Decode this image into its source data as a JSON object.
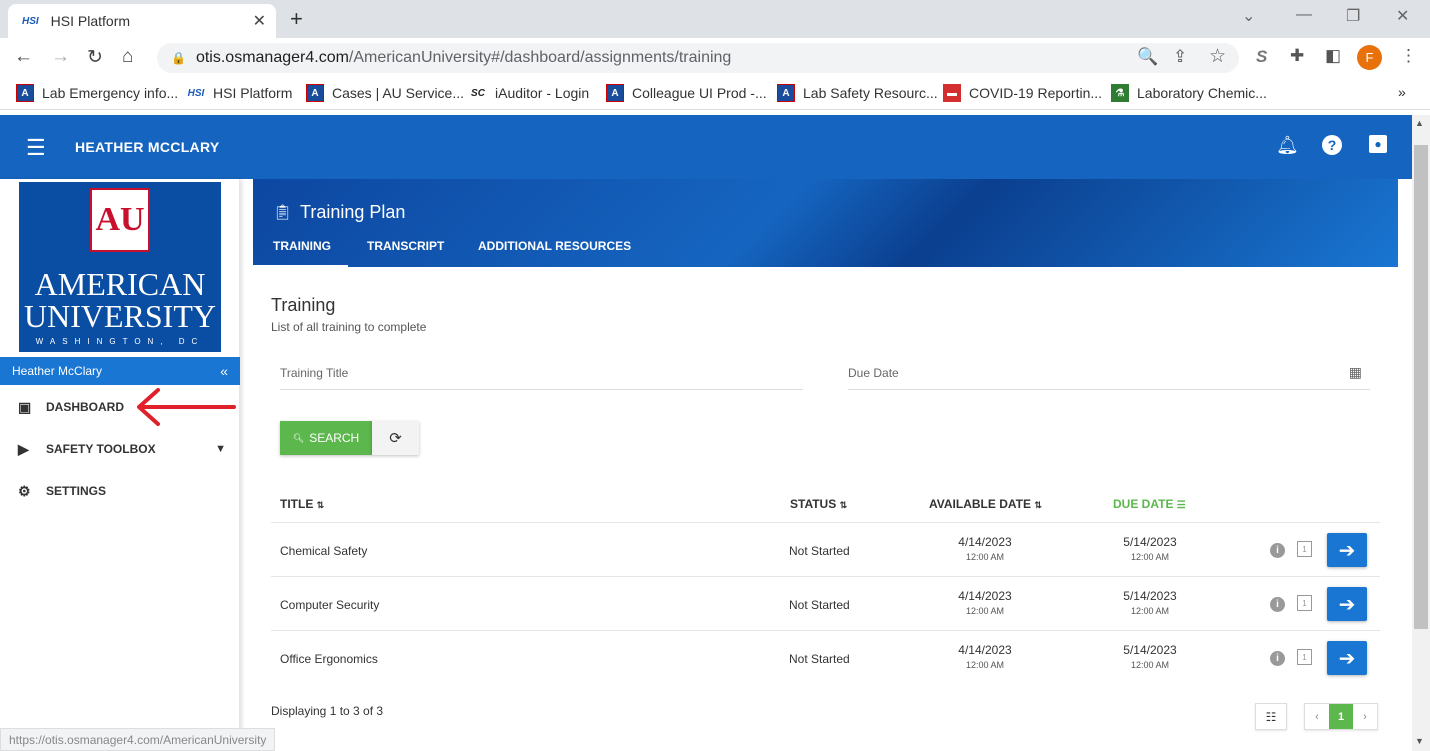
{
  "browser": {
    "tab_title": "HSI Platform",
    "tab_favicon": "HSI",
    "url_host": "otis.osmanager4.com",
    "url_path": "/AmericanUniversity#/dashboard/assignments/training",
    "profile_initial": "F",
    "bookmarks": [
      {
        "label": "Lab Emergency info..."
      },
      {
        "label": "HSI Platform"
      },
      {
        "label": "Cases | AU Service..."
      },
      {
        "label": "iAuditor - Login"
      },
      {
        "label": "Colleague UI Prod -..."
      },
      {
        "label": "Lab Safety Resourc..."
      },
      {
        "label": "COVID-19 Reportin..."
      },
      {
        "label": "Laboratory Chemic..."
      }
    ],
    "bookmarks_overflow": "»",
    "status_url": "https://otis.osmanager4.com/AmericanUniversity"
  },
  "appbar": {
    "user_name": "HEATHER MCCLARY"
  },
  "sidebar": {
    "logo_monogram": "AU",
    "logo_line1": "AMERICAN",
    "logo_line2": "UNIVERSITY",
    "logo_line3": "WASHINGTON, DC",
    "user_label": "Heather McClary",
    "collapse_glyph": "«",
    "items": [
      {
        "label": "DASHBOARD"
      },
      {
        "label": "SAFETY TOOLBOX"
      },
      {
        "label": "SETTINGS"
      }
    ]
  },
  "banner": {
    "title": "Training Plan",
    "tabs": [
      {
        "label": "TRAINING"
      },
      {
        "label": "TRANSCRIPT"
      },
      {
        "label": "ADDITIONAL RESOURCES"
      }
    ]
  },
  "training": {
    "title": "Training",
    "subtitle": "List of all training to complete",
    "title_field_placeholder": "Training Title",
    "due_field_placeholder": "Due Date",
    "search_label": "SEARCH",
    "columns": {
      "title": "TITLE",
      "status": "STATUS",
      "available": "AVAILABLE DATE",
      "due": "DUE DATE"
    },
    "rows": [
      {
        "title": "Chemical Safety",
        "status": "Not Started",
        "available_date": "4/14/2023",
        "available_time": "12:00 AM",
        "due_date": "5/14/2023",
        "due_time": "12:00 AM"
      },
      {
        "title": "Computer Security",
        "status": "Not Started",
        "available_date": "4/14/2023",
        "available_time": "12:00 AM",
        "due_date": "5/14/2023",
        "due_time": "12:00 AM"
      },
      {
        "title": "Office Ergonomics",
        "status": "Not Started",
        "available_date": "4/14/2023",
        "available_time": "12:00 AM",
        "due_date": "5/14/2023",
        "due_time": "12:00 AM"
      }
    ],
    "footer": "Displaying 1 to 3 of 3",
    "current_page": "1"
  },
  "colors": {
    "primary": "#1565c0",
    "accent_green": "#5cb74d",
    "annotation_red": "#e0202a"
  }
}
